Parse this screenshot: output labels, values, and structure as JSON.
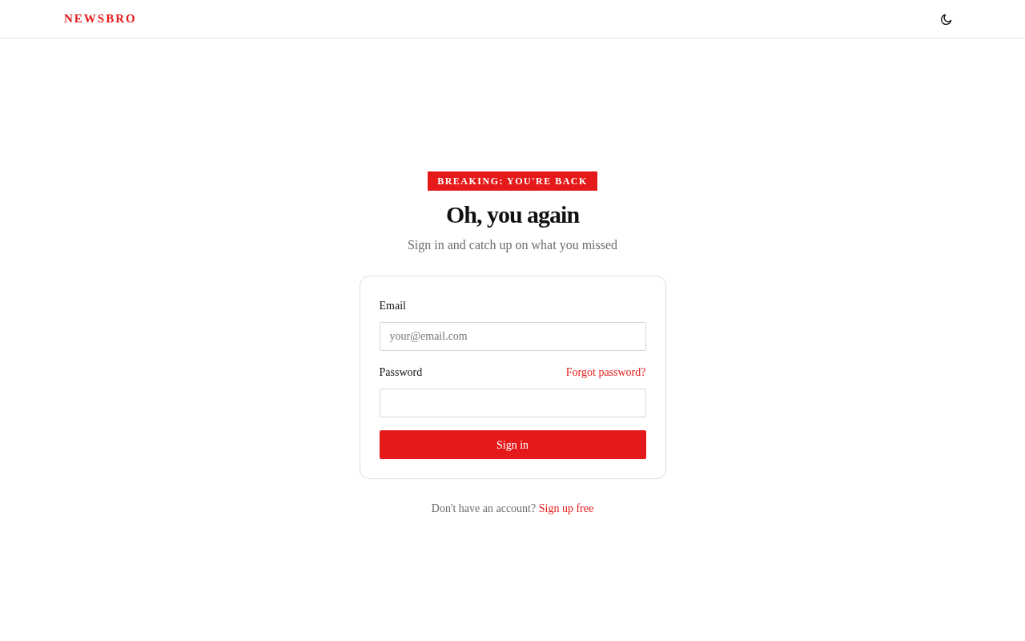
{
  "brand": "NEWSBRO",
  "theme_toggle": {
    "kind": "moon"
  },
  "badge": "BREAKING: YOU'RE BACK",
  "heading": "Oh, you again",
  "subtitle": "Sign in and catch up on what you missed",
  "form": {
    "email_label": "Email",
    "email_placeholder": "your@email.com",
    "password_label": "Password",
    "forgot_link": "Forgot password?",
    "submit": "Sign in"
  },
  "footer": {
    "text": "Don't have an account?",
    "link": "Sign up free"
  }
}
